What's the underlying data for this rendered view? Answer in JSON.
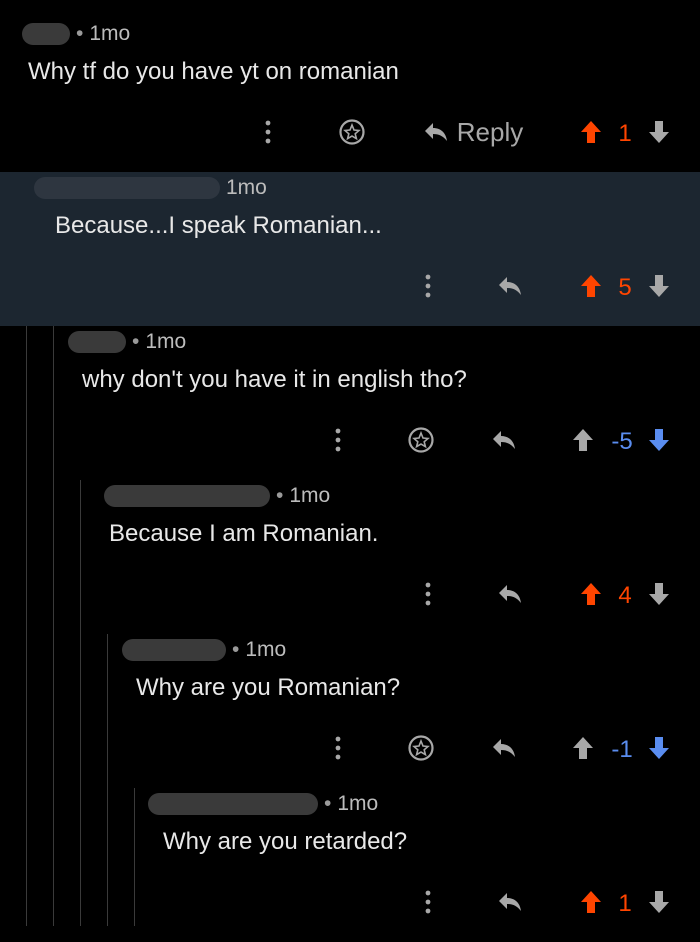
{
  "colors": {
    "upvote": "#ff4500",
    "downvote": "#5a8df0",
    "neutral": "#a8a8a8",
    "highlight_bg": "#1c2630"
  },
  "comments": [
    {
      "age": "1mo",
      "text": "Why tf do you have yt on romanian",
      "reply_label": "Reply",
      "score": "1",
      "vote": "up"
    },
    {
      "age": "1mo",
      "text": "Because...I speak Romanian...",
      "score": "5",
      "vote": "up"
    },
    {
      "age": "1mo",
      "text": "why don't you have it in english tho?",
      "score": "-5",
      "vote": "down"
    },
    {
      "age": "1mo",
      "text": "Because I am Romanian.",
      "score": "4",
      "vote": "up"
    },
    {
      "age": "1mo",
      "text": "Why are you Romanian?",
      "score": "-1",
      "vote": "down"
    },
    {
      "age": "1mo",
      "text": "Why are you retarded?",
      "score": "1",
      "vote": "up"
    }
  ]
}
